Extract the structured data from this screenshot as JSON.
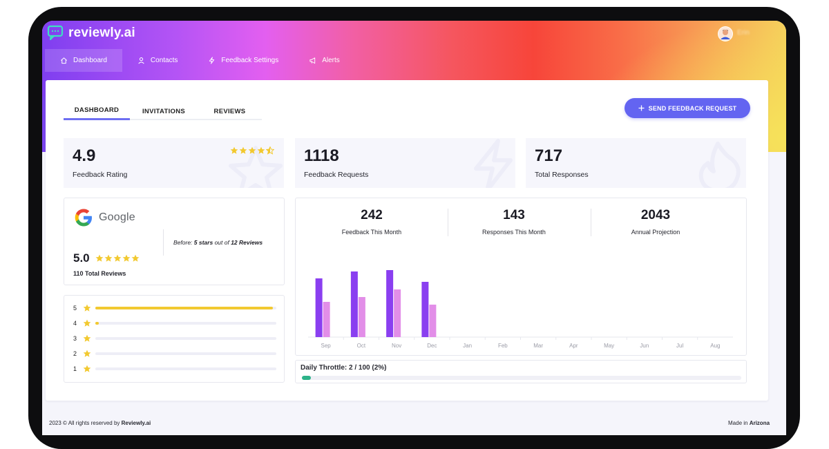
{
  "app": {
    "name": "reviewly.ai",
    "user_name": "Erin"
  },
  "nav": {
    "items": [
      {
        "label": "Dashboard",
        "icon": "home-icon",
        "active": true
      },
      {
        "label": "Contacts",
        "icon": "user-icon",
        "active": false
      },
      {
        "label": "Feedback Settings",
        "icon": "lightning-icon",
        "active": false
      },
      {
        "label": "Alerts",
        "icon": "megaphone-icon",
        "active": false
      }
    ]
  },
  "tabs": [
    {
      "label": "DASHBOARD",
      "active": true
    },
    {
      "label": "INVITATIONS",
      "active": false
    },
    {
      "label": "REVIEWS",
      "active": false
    }
  ],
  "send_button": {
    "label": "SEND FEEDBACK REQUEST",
    "icon": "plus-icon"
  },
  "stats": {
    "rating": {
      "value": "4.9",
      "label": "Feedback Rating",
      "stars": 4.5
    },
    "requests": {
      "value": "1118",
      "label": "Feedback Requests"
    },
    "responses": {
      "value": "717",
      "label": "Total Responses"
    }
  },
  "google": {
    "brand": "Google",
    "before_prefix": "Before: ",
    "before_stars": "5 stars",
    "before_mid": " out of ",
    "before_reviews": "12 Reviews",
    "rating": "5.0",
    "stars": 5,
    "total": "110 Total Reviews"
  },
  "distribution": [
    {
      "star": "5",
      "fraction": 0.98
    },
    {
      "star": "4",
      "fraction": 0.02
    },
    {
      "star": "3",
      "fraction": 0.0
    },
    {
      "star": "2",
      "fraction": 0.0
    },
    {
      "star": "1",
      "fraction": 0.0
    }
  ],
  "kpis": [
    {
      "value": "242",
      "label": "Feedback This Month"
    },
    {
      "value": "143",
      "label": "Responses This Month"
    },
    {
      "value": "2043",
      "label": "Annual Projection"
    }
  ],
  "chart_data": {
    "type": "bar",
    "categories": [
      "Sep",
      "Oct",
      "Nov",
      "Dec",
      "Jan",
      "Feb",
      "Mar",
      "Apr",
      "May",
      "Jun",
      "Jul",
      "Aug"
    ],
    "series": [
      {
        "color": "#8a3ff0",
        "values": [
          85,
          95,
          97,
          80,
          0,
          0,
          0,
          0,
          0,
          0,
          0,
          0
        ]
      },
      {
        "color": "#e28ee8",
        "values": [
          51,
          58,
          69,
          47,
          0,
          0,
          0,
          0,
          0,
          0,
          0,
          0
        ]
      }
    ],
    "ylim": [
      0,
      100
    ]
  },
  "throttle": {
    "label": "Daily Throttle: 2 / 100 (2%)",
    "fraction": 0.02
  },
  "footer": {
    "left_prefix": "2023 © All rights reserved by ",
    "left_brand": "Reviewly.ai",
    "right_prefix": "Made in ",
    "right_place": "Arizona"
  },
  "colors": {
    "accent": "#6364f1",
    "star": "#f2c930",
    "throttle": "#2db389"
  }
}
